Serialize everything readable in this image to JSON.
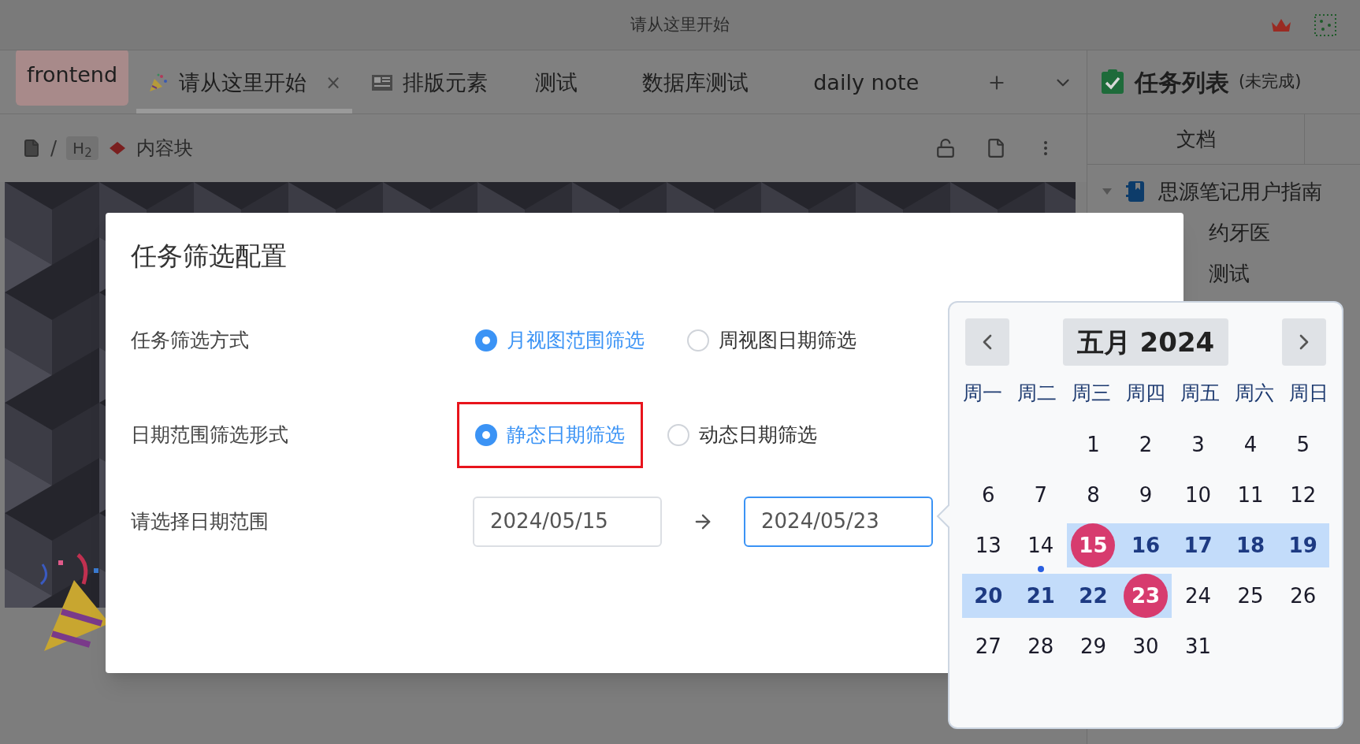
{
  "window": {
    "title": "请从这里开始"
  },
  "tabs": [
    {
      "label": "frontend",
      "kind": "notebook",
      "selected": false
    },
    {
      "label": "请从这里开始",
      "kind": "party",
      "selected": true,
      "close": "×"
    },
    {
      "label": "排版元素",
      "kind": "news",
      "selected": false
    },
    {
      "label": "测试",
      "kind": "plain",
      "selected": false
    },
    {
      "label": "数据库测试",
      "kind": "plain",
      "selected": false
    },
    {
      "label": "daily note",
      "kind": "plain",
      "selected": false
    }
  ],
  "breadcrumb": {
    "separator": "/",
    "heading": "H$_{2}$",
    "block": "内容块"
  },
  "side_panel": {
    "title": "任务列表",
    "subtitle": "(未完成)",
    "tabs": [
      {
        "label": "文档"
      }
    ],
    "tree": [
      {
        "label": "思源笔记用户指南",
        "expanded": true,
        "children": [
          {
            "label": "约牙医"
          },
          {
            "label": "测试"
          }
        ]
      }
    ]
  },
  "dialog": {
    "title": "任务筛选配置",
    "rows": [
      {
        "kind": "radio",
        "label": "任务筛选方式",
        "options": [
          {
            "label": "月视图范围筛选",
            "selected": true,
            "highlighted": false
          },
          {
            "label": "周视图日期筛选",
            "selected": false,
            "highlighted": false
          }
        ]
      },
      {
        "kind": "radio",
        "label": "日期范围筛选形式",
        "options": [
          {
            "label": "静态日期筛选",
            "selected": true,
            "highlighted": true
          },
          {
            "label": "动态日期筛选",
            "selected": false,
            "highlighted": false
          }
        ]
      },
      {
        "kind": "range",
        "label": "请选择日期范围",
        "start": "2024/05/15",
        "end": "2024/05/23",
        "end_focused": true
      }
    ]
  },
  "calendar": {
    "title": "五月 2024",
    "weekdays": [
      "周一",
      "周二",
      "周三",
      "周四",
      "周五",
      "周六",
      "周日"
    ],
    "weeks": [
      [
        {
          "kind": "blank"
        },
        {
          "kind": "blank"
        },
        {
          "kind": "day",
          "label": "1",
          "selected": false,
          "in_range": false,
          "today": false
        },
        {
          "kind": "day",
          "label": "2",
          "selected": false,
          "in_range": false,
          "today": false
        },
        {
          "kind": "day",
          "label": "3",
          "selected": false,
          "in_range": false,
          "today": false
        },
        {
          "kind": "day",
          "label": "4",
          "selected": false,
          "in_range": false,
          "today": false
        },
        {
          "kind": "day",
          "label": "5",
          "selected": false,
          "in_range": false,
          "today": false
        }
      ],
      [
        {
          "kind": "day",
          "label": "6",
          "selected": false,
          "in_range": false,
          "today": false
        },
        {
          "kind": "day",
          "label": "7",
          "selected": false,
          "in_range": false,
          "today": false
        },
        {
          "kind": "day",
          "label": "8",
          "selected": false,
          "in_range": false,
          "today": false
        },
        {
          "kind": "day",
          "label": "9",
          "selected": false,
          "in_range": false,
          "today": false
        },
        {
          "kind": "day",
          "label": "10",
          "selected": false,
          "in_range": false,
          "today": false
        },
        {
          "kind": "day",
          "label": "11",
          "selected": false,
          "in_range": false,
          "today": false
        },
        {
          "kind": "day",
          "label": "12",
          "selected": false,
          "in_range": false,
          "today": false
        }
      ],
      [
        {
          "kind": "day",
          "label": "13",
          "selected": false,
          "in_range": false,
          "today": false
        },
        {
          "kind": "day",
          "label": "14",
          "selected": false,
          "in_range": false,
          "today": true
        },
        {
          "kind": "day",
          "label": "15",
          "selected": true,
          "in_range": true,
          "today": false
        },
        {
          "kind": "day",
          "label": "16",
          "selected": false,
          "in_range": true,
          "today": false
        },
        {
          "kind": "day",
          "label": "17",
          "selected": false,
          "in_range": true,
          "today": false
        },
        {
          "kind": "day",
          "label": "18",
          "selected": false,
          "in_range": true,
          "today": false
        },
        {
          "kind": "day",
          "label": "19",
          "selected": false,
          "in_range": true,
          "today": false
        }
      ],
      [
        {
          "kind": "day",
          "label": "20",
          "selected": false,
          "in_range": true,
          "today": false
        },
        {
          "kind": "day",
          "label": "21",
          "selected": false,
          "in_range": true,
          "today": false
        },
        {
          "kind": "day",
          "label": "22",
          "selected": false,
          "in_range": true,
          "today": false
        },
        {
          "kind": "day",
          "label": "23",
          "selected": true,
          "in_range": true,
          "today": false
        },
        {
          "kind": "day",
          "label": "24",
          "selected": false,
          "in_range": false,
          "today": false
        },
        {
          "kind": "day",
          "label": "25",
          "selected": false,
          "in_range": false,
          "today": false
        },
        {
          "kind": "day",
          "label": "26",
          "selected": false,
          "in_range": false,
          "today": false
        }
      ],
      [
        {
          "kind": "day",
          "label": "27",
          "selected": false,
          "in_range": false,
          "today": false
        },
        {
          "kind": "day",
          "label": "28",
          "selected": false,
          "in_range": false,
          "today": false
        },
        {
          "kind": "day",
          "label": "29",
          "selected": false,
          "in_range": false,
          "today": false
        },
        {
          "kind": "day",
          "label": "30",
          "selected": false,
          "in_range": false,
          "today": false
        },
        {
          "kind": "day",
          "label": "31",
          "selected": false,
          "in_range": false,
          "today": false
        }
      ]
    ]
  }
}
